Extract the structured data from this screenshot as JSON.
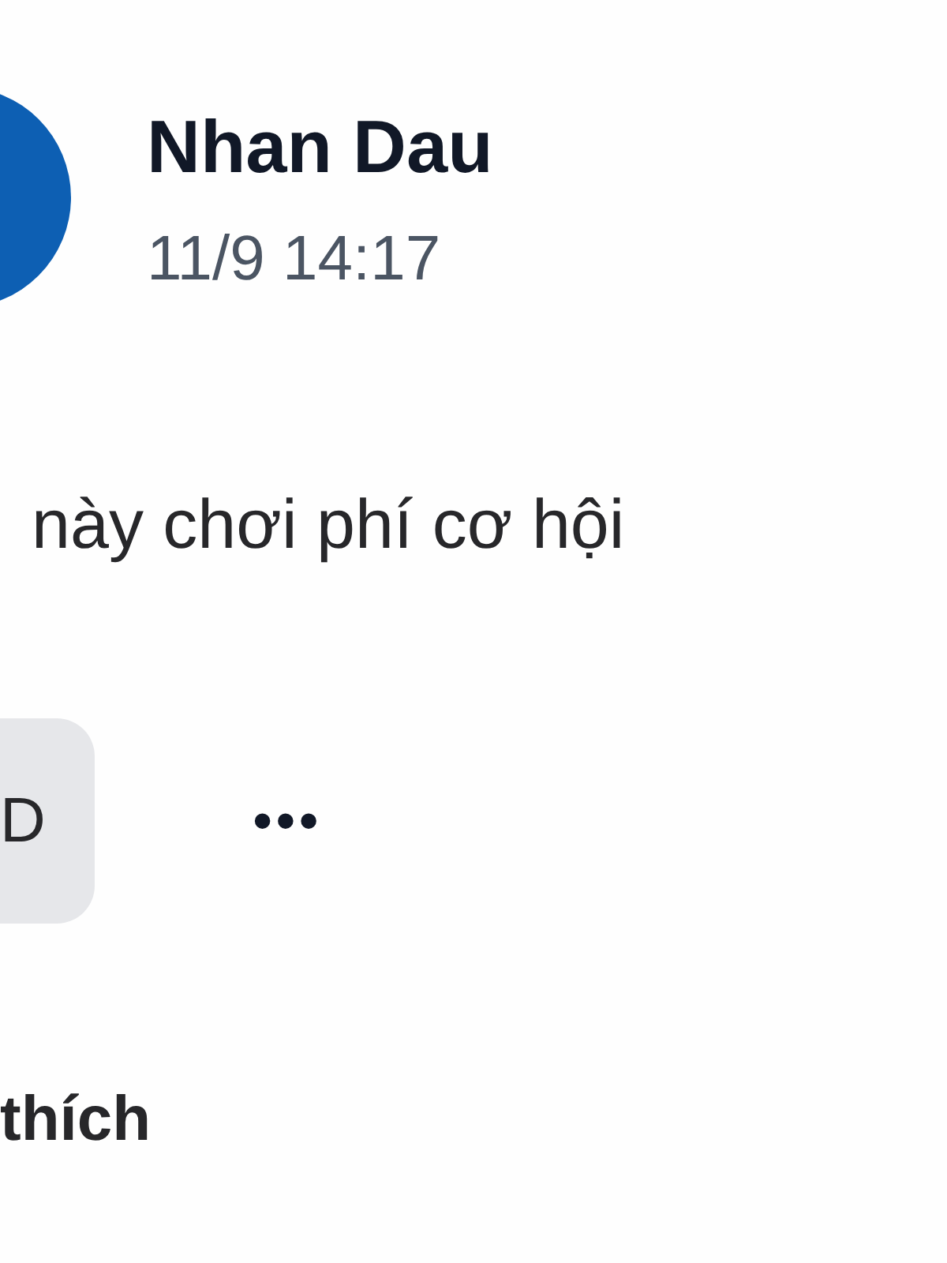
{
  "post": {
    "author": "Nhan Dau",
    "time": "11/9 14:17",
    "text": "này chơi phí cơ hội"
  },
  "actions": {
    "chip": "D",
    "more": "•••"
  },
  "footer": {
    "label": "thích"
  }
}
